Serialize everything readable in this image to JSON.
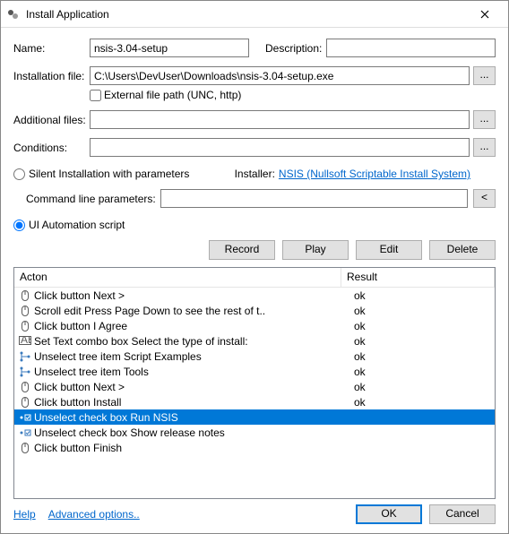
{
  "window": {
    "title": "Install Application"
  },
  "labels": {
    "name": "Name:",
    "description": "Description:",
    "installation_file": "Installation file:",
    "external_path": "External file path (UNC, http)",
    "additional_files": "Additional files:",
    "conditions": "Conditions:",
    "silent": "Silent Installation with parameters",
    "installer": "Installer:",
    "installer_link": "NSIS (Nullsoft Scriptable Install System)",
    "cmd_params": "Command line parameters:",
    "ui_auto": "UI Automation script",
    "help": "Help",
    "advanced": "Advanced options..",
    "ok": "OK",
    "cancel": "Cancel",
    "dots": "...",
    "lt": "<"
  },
  "fields": {
    "name": "nsis-3.04-setup",
    "description": "",
    "installation_file": "C:\\Users\\DevUser\\Downloads\\nsis-3.04-setup.exe",
    "additional_files": "",
    "conditions": "",
    "cmd_params": "",
    "external_checked": false,
    "mode": "ui"
  },
  "buttons": {
    "record": "Record",
    "play": "Play",
    "edit": "Edit",
    "delete": "Delete"
  },
  "grid": {
    "headers": {
      "action": "Acton",
      "result": "Result"
    },
    "rows": [
      {
        "icon": "mouse",
        "action": "Click button Next >",
        "result": "ok",
        "selected": false
      },
      {
        "icon": "mouse",
        "action": "Scroll edit Press Page Down to see the rest of t..",
        "result": "ok",
        "selected": false
      },
      {
        "icon": "mouse",
        "action": "Click button I Agree",
        "result": "ok",
        "selected": false
      },
      {
        "icon": "text",
        "action": "Set Text combo box Select the type of install:",
        "result": "ok",
        "selected": false
      },
      {
        "icon": "tree",
        "action": "Unselect tree item Script Examples",
        "result": "ok",
        "selected": false
      },
      {
        "icon": "tree",
        "action": "Unselect tree item Tools",
        "result": "ok",
        "selected": false
      },
      {
        "icon": "mouse",
        "action": "Click button Next >",
        "result": "ok",
        "selected": false
      },
      {
        "icon": "mouse",
        "action": "Click button Install",
        "result": "ok",
        "selected": false
      },
      {
        "icon": "check",
        "action": "Unselect check box Run NSIS",
        "result": "",
        "selected": true
      },
      {
        "icon": "check",
        "action": "Unselect check box Show release notes",
        "result": "",
        "selected": false
      },
      {
        "icon": "mouse",
        "action": "Click button Finish",
        "result": "",
        "selected": false
      }
    ]
  }
}
